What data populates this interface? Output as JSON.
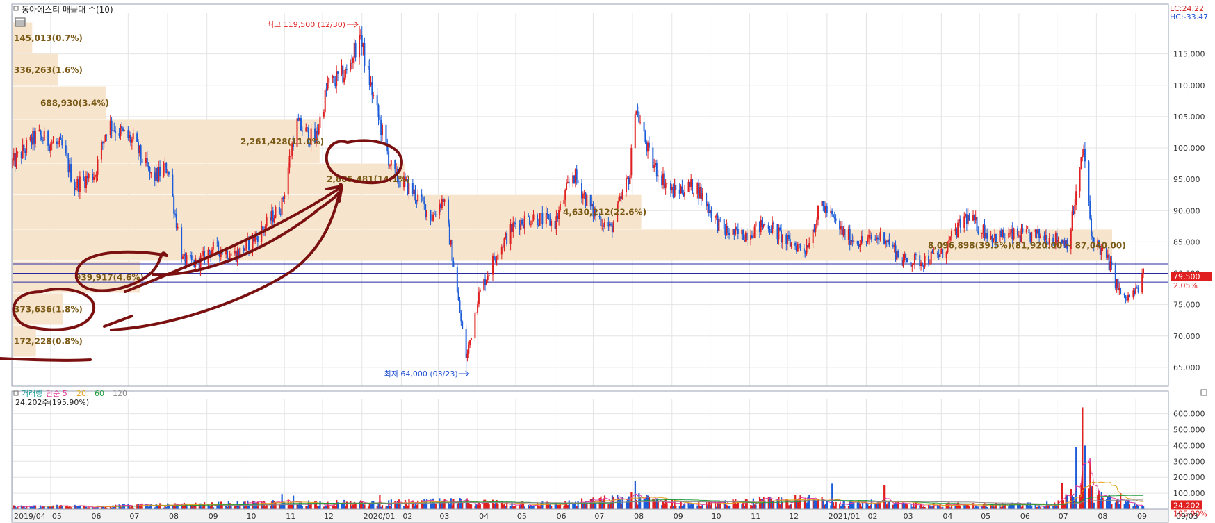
{
  "chart_data": [
    {
      "type": "candlestick",
      "title": "동아에스티 매물대 수(10)",
      "ylim": [
        62000,
        121500
      ],
      "y_ticks": [
        "115,000",
        "110,000",
        "105,000",
        "100,000",
        "95,000",
        "90,000",
        "85,000",
        "80,000",
        "75,000",
        "70,000",
        "65,000"
      ],
      "y_tick_values": [
        115000,
        110000,
        105000,
        100000,
        95000,
        90000,
        85000,
        80000,
        75000,
        70000,
        65000
      ],
      "lc_label": "LC:24.22",
      "hc_label": "HC:-33.47",
      "price_label": "79,500",
      "change_label": "2.05%",
      "high": {
        "label": "최고 119,500 (12/30)",
        "value": 119500,
        "date": "2019/12/30"
      },
      "low": {
        "label": "최저 64,000 (03/23)",
        "value": 64000,
        "date": "2020/03/23"
      },
      "horizontal_lines": [
        81500,
        80000,
        78600
      ],
      "price_anchors": [
        [
          "2019/04/01",
          97500
        ],
        [
          "2019/04/20",
          102000
        ],
        [
          "2019/05/10",
          100000
        ],
        [
          "2019/05/20",
          94000
        ],
        [
          "2019/06/05",
          96000
        ],
        [
          "2019/06/15",
          104000
        ],
        [
          "2019/07/05",
          101000
        ],
        [
          "2019/07/20",
          95000
        ],
        [
          "2019/08/01",
          97000
        ],
        [
          "2019/08/13",
          82000
        ],
        [
          "2019/08/25",
          81500
        ],
        [
          "2019/09/05",
          84000
        ],
        [
          "2019/09/25",
          83000
        ],
        [
          "2019/10/15",
          87000
        ],
        [
          "2019/10/30",
          91000
        ],
        [
          "2019/11/10",
          104000
        ],
        [
          "2019/11/25",
          101000
        ],
        [
          "2019/12/05",
          110000
        ],
        [
          "2019/12/20",
          112000
        ],
        [
          "2019/12/30",
          118000
        ],
        [
          "2020/01/10",
          108000
        ],
        [
          "2020/01/25",
          96000
        ],
        [
          "2020/02/10",
          93000
        ],
        [
          "2020/02/25",
          89000
        ],
        [
          "2020/03/05",
          92000
        ],
        [
          "2020/03/12",
          83000
        ],
        [
          "2020/03/23",
          66000
        ],
        [
          "2020/04/01",
          76000
        ],
        [
          "2020/04/15",
          83000
        ],
        [
          "2020/05/01",
          88000
        ],
        [
          "2020/05/15",
          89000
        ],
        [
          "2020/06/01",
          88000
        ],
        [
          "2020/06/15",
          96000
        ],
        [
          "2020/06/30",
          90000
        ],
        [
          "2020/07/15",
          87000
        ],
        [
          "2020/07/30",
          96000
        ],
        [
          "2020/08/03",
          107000
        ],
        [
          "2020/08/15",
          98000
        ],
        [
          "2020/09/01",
          93000
        ],
        [
          "2020/09/20",
          94000
        ],
        [
          "2020/10/10",
          87000
        ],
        [
          "2020/10/25",
          86000
        ],
        [
          "2020/11/15",
          88000
        ],
        [
          "2020/11/30",
          85000
        ],
        [
          "2020/12/15",
          84000
        ],
        [
          "2020/12/28",
          91000
        ],
        [
          "2021/01/15",
          86000
        ],
        [
          "2021/01/30",
          85000
        ],
        [
          "2021/02/15",
          86000
        ],
        [
          "2021/03/01",
          82000
        ],
        [
          "2021/03/15",
          82000
        ],
        [
          "2021/04/01",
          83000
        ],
        [
          "2021/04/20",
          89000
        ],
        [
          "2021/05/10",
          86000
        ],
        [
          "2021/05/30",
          86000
        ],
        [
          "2021/06/20",
          86000
        ],
        [
          "2021/07/10",
          85000
        ],
        [
          "2021/07/22",
          100000
        ],
        [
          "2021/07/28",
          86000
        ],
        [
          "2021/08/10",
          82000
        ],
        [
          "2021/08/22",
          75500
        ],
        [
          "2021/09/01",
          77000
        ],
        [
          "2021/09/07",
          79500
        ]
      ],
      "date_range": [
        "2019/04/01",
        "2021/09/07"
      ],
      "x_axis_labels": [
        {
          "label": "2019/04",
          "date": "2019/04/01"
        },
        {
          "label": "05",
          "date": "2019/05/01"
        },
        {
          "label": "06",
          "date": "2019/06/01"
        },
        {
          "label": "07",
          "date": "2019/07/01"
        },
        {
          "label": "08",
          "date": "2019/08/01"
        },
        {
          "label": "09",
          "date": "2019/09/01"
        },
        {
          "label": "10",
          "date": "2019/10/01"
        },
        {
          "label": "11",
          "date": "2019/11/01"
        },
        {
          "label": "12",
          "date": "2019/12/01"
        },
        {
          "label": "2020/01",
          "date": "2020/01/01"
        },
        {
          "label": "02",
          "date": "2020/02/01"
        },
        {
          "label": "03",
          "date": "2020/03/01"
        },
        {
          "label": "04",
          "date": "2020/04/01"
        },
        {
          "label": "05",
          "date": "2020/05/01"
        },
        {
          "label": "06",
          "date": "2020/06/01"
        },
        {
          "label": "07",
          "date": "2020/07/01"
        },
        {
          "label": "08",
          "date": "2020/08/01"
        },
        {
          "label": "09",
          "date": "2020/09/01"
        },
        {
          "label": "10",
          "date": "2020/10/01"
        },
        {
          "label": "11",
          "date": "2020/11/01"
        },
        {
          "label": "12",
          "date": "2020/12/01"
        },
        {
          "label": "2021/01",
          "date": "2021/01/01"
        },
        {
          "label": "02",
          "date": "2021/02/01"
        },
        {
          "label": "03",
          "date": "2021/03/01"
        },
        {
          "label": "04",
          "date": "2021/04/01"
        },
        {
          "label": "05",
          "date": "2021/05/01"
        },
        {
          "label": "06",
          "date": "2021/06/01"
        },
        {
          "label": "07",
          "date": "2021/07/01"
        },
        {
          "label": "08",
          "date": "2021/08/01"
        },
        {
          "label": "09",
          "date": "2021/09/01"
        }
      ],
      "x_axis_right_label": "09/03",
      "volume_profile": [
        {
          "label": "145,013(0.7%)",
          "volume": 145013,
          "price_low": 115000,
          "price_high": 120000
        },
        {
          "label": "336,263(1.6%)",
          "volume": 336263,
          "price_low": 109800,
          "price_high": 115000
        },
        {
          "label": "688,930(3.4%)",
          "volume": 688930,
          "price_low": 104500,
          "price_high": 109800
        },
        {
          "label": "2,261,428(11.0%)",
          "volume": 2261428,
          "price_low": 97500,
          "price_high": 104500
        },
        {
          "label": "2,885,481(14.1%)",
          "volume": 2885481,
          "price_low": 92500,
          "price_high": 97500
        },
        {
          "label": "4,630,212(22.6%)",
          "volume": 4630212,
          "price_low": 87000,
          "price_high": 92500
        },
        {
          "label": "8,096,898(39.5%)(81,920.00 ~ 87,040.00)",
          "volume": 8096898,
          "price_low": 81900,
          "price_high": 87000
        },
        {
          "label": "939,917(4.6%)",
          "volume": 939917,
          "price_low": 76800,
          "price_high": 81900
        },
        {
          "label": "373,636(1.8%)",
          "volume": 373636,
          "price_low": 71700,
          "price_high": 76800
        },
        {
          "label": "172,228(0.8%)",
          "volume": 172228,
          "price_low": 66600,
          "price_high": 71700
        }
      ]
    },
    {
      "type": "bar",
      "title": "거래량",
      "legend": [
        {
          "name": "거래량",
          "color": "#159a9a"
        },
        {
          "name": "단순 5",
          "color": "#e0389c"
        },
        {
          "name": "20",
          "color": "#e2a21a"
        },
        {
          "name": "60",
          "color": "#1f9a3a"
        },
        {
          "name": "120",
          "color": "#888888"
        }
      ],
      "current_label": "24,202주(195.90%)",
      "ylim": [
        0,
        690000
      ],
      "y_ticks": [
        "600,000",
        "500,000",
        "400,000",
        "300,000",
        "200,000",
        "100,000"
      ],
      "y_tick_values": [
        600000,
        500000,
        400000,
        300000,
        200000,
        100000
      ],
      "volume_label": "24,202",
      "ratio_label": "195.90%",
      "volume_anchors": [
        [
          "2019/04/01",
          15000
        ],
        [
          "2019/08/15",
          25000
        ],
        [
          "2019/11/10",
          40000
        ],
        [
          "2020/01/01",
          35000
        ],
        [
          "2020/03/20",
          45000
        ],
        [
          "2020/06/01",
          30000
        ],
        [
          "2020/08/03",
          70000
        ],
        [
          "2020/09/15",
          30000
        ],
        [
          "2020/12/20",
          60000
        ],
        [
          "2021/01/15",
          45000
        ],
        [
          "2021/03/01",
          30000
        ],
        [
          "2021/05/01",
          25000
        ],
        [
          "2021/07/01",
          30000
        ],
        [
          "2021/07/20",
          120000
        ],
        [
          "2021/08/10",
          60000
        ],
        [
          "2021/09/07",
          20000
        ]
      ],
      "volume_spikes": [
        [
          "2019/10/30",
          95000
        ],
        [
          "2019/11/08",
          85000
        ],
        [
          "2020/01/15",
          90000
        ],
        [
          "2020/08/03",
          175000
        ],
        [
          "2020/12/20",
          195000
        ],
        [
          "2021/01/05",
          160000
        ],
        [
          "2021/02/15",
          150000
        ],
        [
          "2021/07/05",
          165000
        ],
        [
          "2021/07/16",
          390000
        ],
        [
          "2021/07/21",
          640000
        ],
        [
          "2021/07/23",
          400000
        ],
        [
          "2021/07/27",
          300000
        ],
        [
          "2021/08/20",
          100000
        ]
      ]
    }
  ],
  "colors": {
    "up": "#e02020",
    "down": "#1c5cd8",
    "profile": "#f6e4cc",
    "profile_text": "#7a5a16",
    "annotation": "#7a1010",
    "grid": "#e4e4e4",
    "line": "#2a2aa0"
  }
}
